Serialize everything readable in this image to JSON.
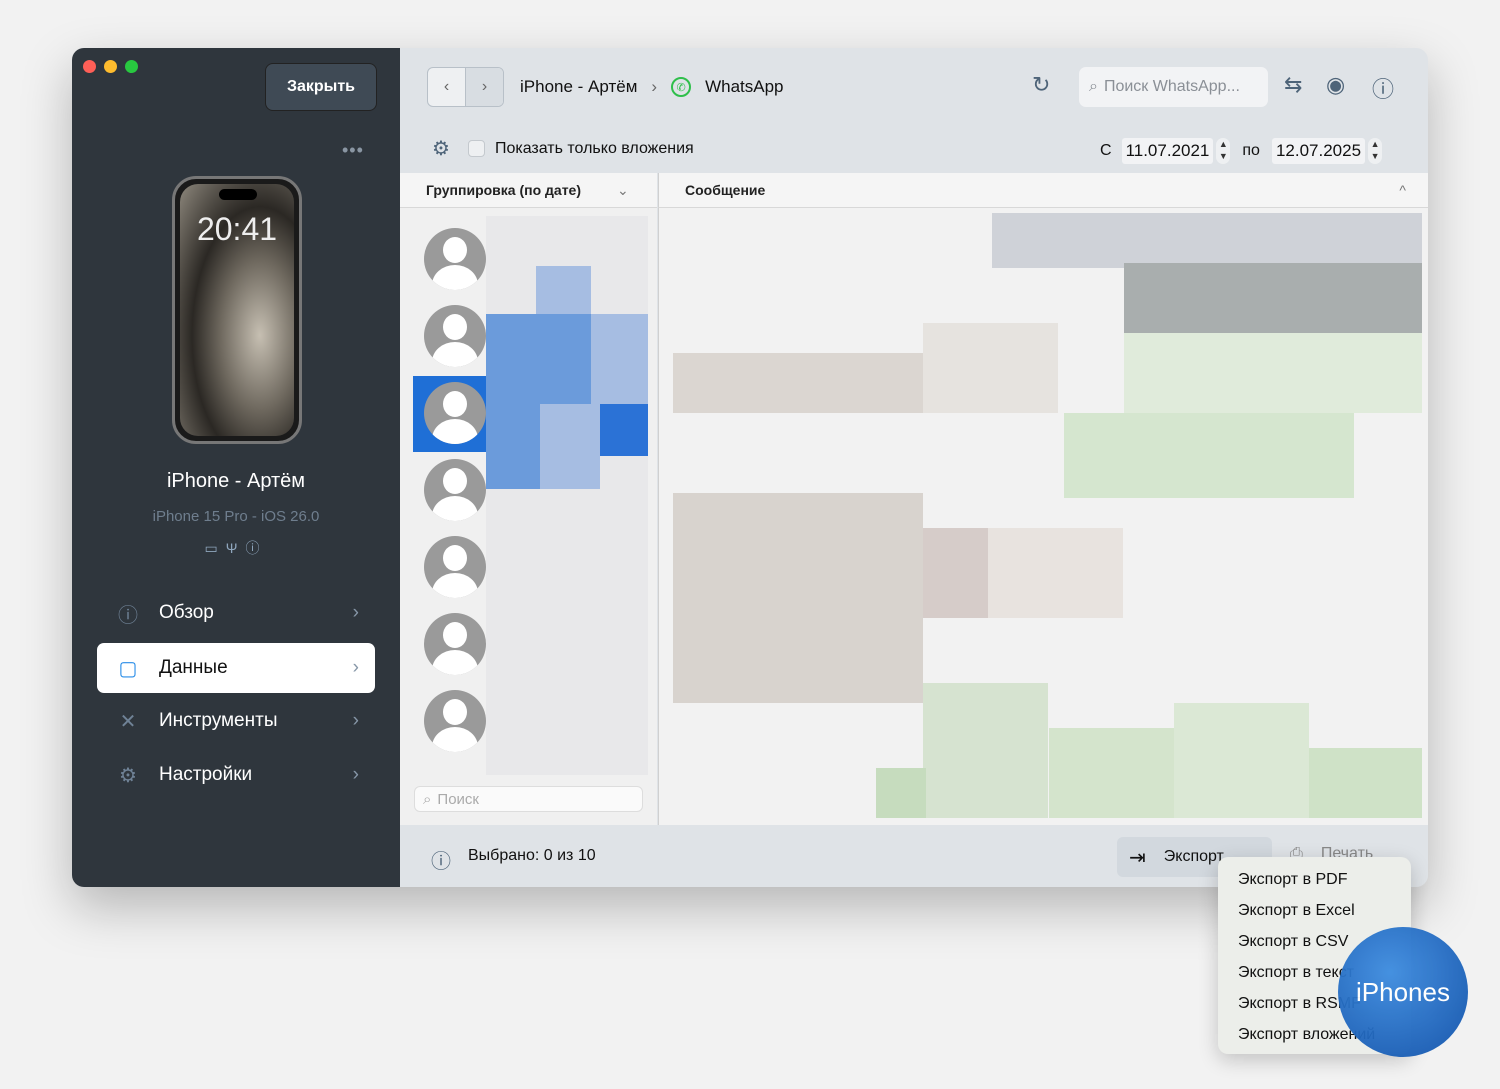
{
  "sidebar": {
    "close_label": "Закрыть",
    "more": "•••",
    "phone_time": "20:41",
    "device_name": "iPhone - Артём",
    "device_model": "iPhone 15 Pro - iOS 26.0",
    "nav": [
      {
        "label": "Обзор",
        "icon": "info-icon"
      },
      {
        "label": "Данные",
        "icon": "square-icon"
      },
      {
        "label": "Инструменты",
        "icon": "tools-icon"
      },
      {
        "label": "Настройки",
        "icon": "gear-icon"
      }
    ]
  },
  "toolbar": {
    "crumb_device": "iPhone - Артём",
    "crumb_app": "WhatsApp",
    "search_placeholder": "Поиск WhatsApp...",
    "attachments_only": "Показать только вложения",
    "from_label": "С",
    "from_date": "11.07.2021",
    "to_label": "по",
    "to_date": "12.07.2025"
  },
  "list": {
    "header": "Группировка (по дате)",
    "search_placeholder": "Поиск"
  },
  "messages": {
    "header": "Сообщение"
  },
  "footer": {
    "selected": "Выбрано: 0 из 10",
    "export_label": "Экспорт",
    "print_label": "Печать"
  },
  "export_menu": [
    "Экспорт в PDF",
    "Экспорт в Excel",
    "Экспорт в CSV",
    "Экспорт в текст",
    "Экспорт в RSMF",
    "Экспорт вложений"
  ],
  "watermark": "iPhones",
  "colors": {
    "accent": "#2b8ee8",
    "sidebar": "#2f363d",
    "selected_row": "#1f6fd6"
  }
}
